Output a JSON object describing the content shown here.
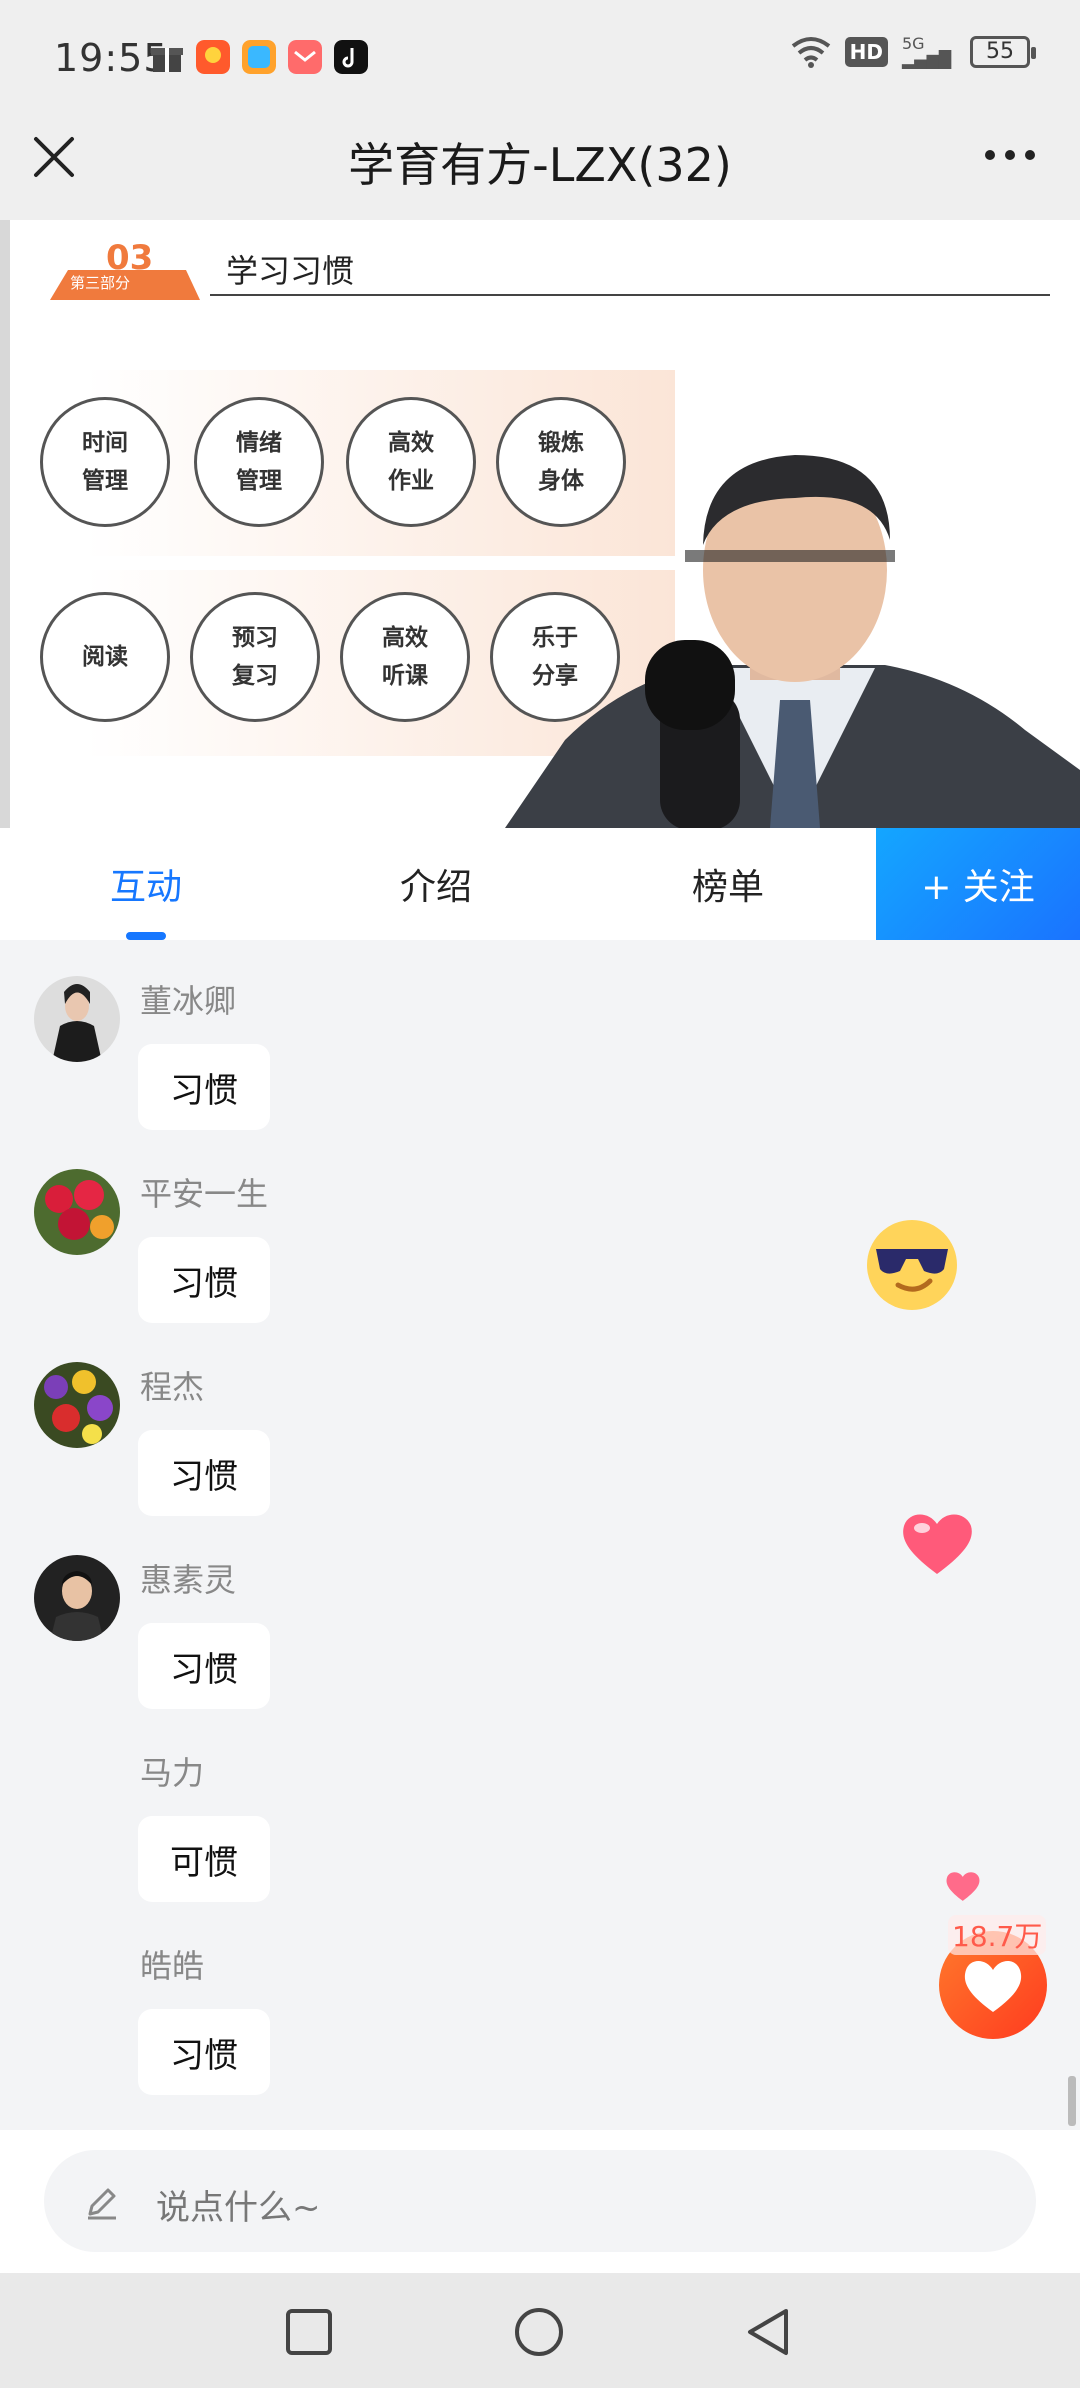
{
  "status_bar": {
    "time": "19:55",
    "network": "5G",
    "hd": "HD",
    "battery": "55"
  },
  "header": {
    "title": "学育有方-LZX(32)"
  },
  "slide": {
    "section_number": "03",
    "section_label": "第三部分",
    "title": "学习习惯",
    "circles_row1": [
      {
        "line1": "时间",
        "line2": "管理"
      },
      {
        "line1": "情绪",
        "line2": "管理"
      },
      {
        "line1": "高效",
        "line2": "作业"
      },
      {
        "line1": "锻炼",
        "line2": "身体"
      }
    ],
    "circles_row2": [
      {
        "line1": "阅读",
        "line2": ""
      },
      {
        "line1": "预习",
        "line2": "复习"
      },
      {
        "line1": "高效",
        "line2": "听课"
      },
      {
        "line1": "乐于",
        "line2": "分享"
      }
    ]
  },
  "tabs": {
    "interact": "互动",
    "intro": "介绍",
    "ranking": "榜单",
    "follow": "+ 关注"
  },
  "messages": [
    {
      "user": "董冰卿",
      "text": "习惯",
      "avatar": "person-avatar"
    },
    {
      "user": "平安一生",
      "text": "习惯",
      "avatar": "roses-avatar"
    },
    {
      "user": "程杰",
      "text": "习惯",
      "avatar": "flowers-avatar"
    },
    {
      "user": "惠素灵",
      "text": "习惯",
      "avatar": "child-avatar"
    },
    {
      "user": "马力",
      "text": "可惯",
      "avatar": ""
    },
    {
      "user": "皓皓",
      "text": "习惯",
      "avatar": ""
    }
  ],
  "likes": {
    "count": "18.7万"
  },
  "input": {
    "placeholder": "说点什么~"
  },
  "colors": {
    "accent": "#1677ff",
    "like": "#ff4d2e"
  }
}
